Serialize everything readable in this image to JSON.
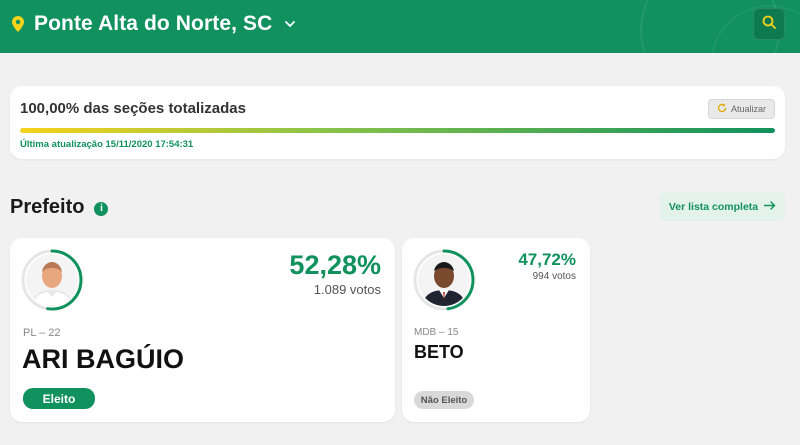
{
  "header": {
    "location": "Ponte Alta do Norte, SC",
    "icons": {
      "pin": "map-pin-icon",
      "chevron": "chevron-down-icon",
      "search": "search-icon"
    },
    "colors": {
      "brand_green": "#10915d",
      "accent_yellow": "#f6d21a"
    }
  },
  "progress": {
    "title": "100,00% das seções totalizadas",
    "refresh_label": "Atualizar",
    "updated_label": "Última atualização 15/11/2020 17:54:31",
    "fraction": 1.0
  },
  "section": {
    "title": "Prefeito",
    "list_button_label": "Ver lista completa"
  },
  "candidates": [
    {
      "name": "ARI BAGÚIO",
      "party": "PL – 22",
      "percent": "52,28%",
      "votes": "1.089 votos",
      "status": "Eleito",
      "vote_share": 0.5228
    },
    {
      "name": "BETO",
      "party": "MDB – 15",
      "percent": "47,72%",
      "votes": "994 votos",
      "status": "Não Eleito",
      "vote_share": 0.4772
    }
  ]
}
